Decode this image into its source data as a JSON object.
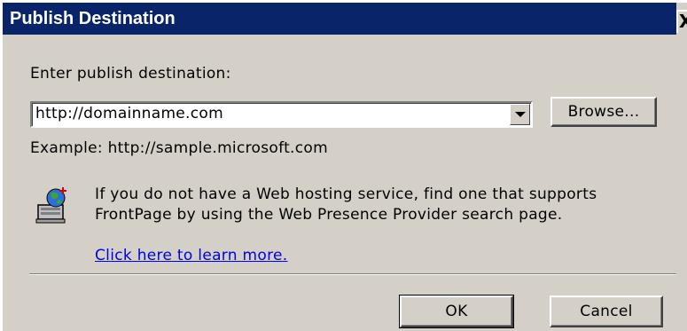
{
  "window": {
    "title": "Publish Destination",
    "close_glyph": "X"
  },
  "form": {
    "prompt_label": "Enter publish destination:",
    "destination_value": "http://domainname.com",
    "browse_label": "Browse...",
    "example_text": "Example: http://sample.microsoft.com"
  },
  "info": {
    "icon": "web-server-globe-icon",
    "line1": "If you do not have a Web hosting service, find one that supports",
    "line2": "FrontPage by using the Web Presence Provider search page.",
    "link_text": "Click here to learn more."
  },
  "footer": {
    "ok_label": "OK",
    "cancel_label": "Cancel"
  },
  "colors": {
    "titlebar": "#0a246a",
    "dialog_face": "#d4d0c8",
    "link": "#0000ee"
  }
}
